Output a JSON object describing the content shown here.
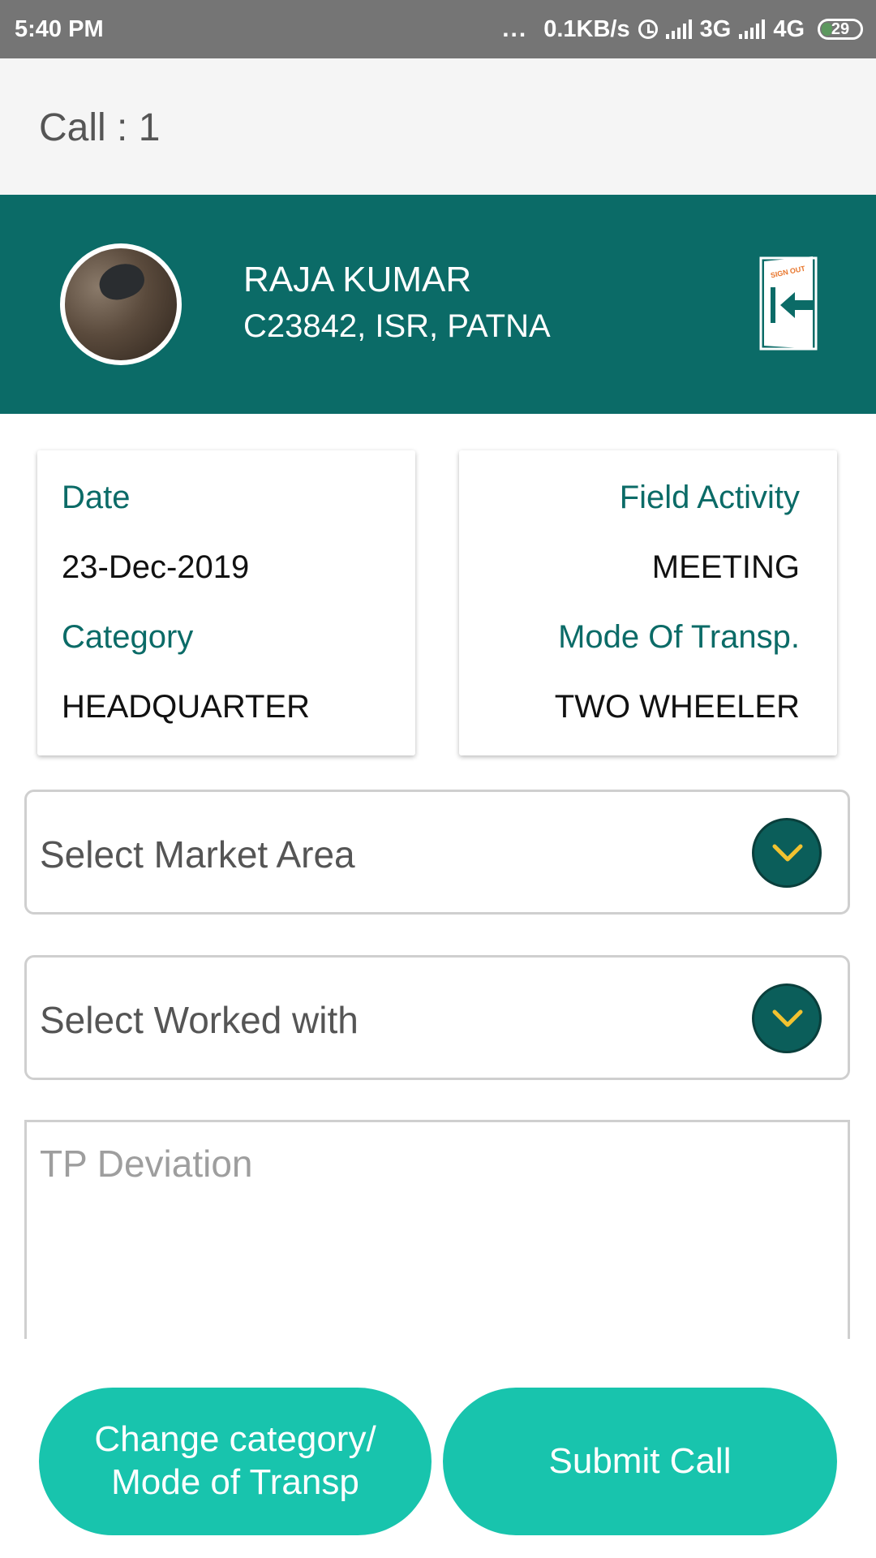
{
  "status_bar": {
    "time": "5:40 PM",
    "dots": "...",
    "network_speed": "0.1KB/s",
    "network1": "3G",
    "network2": "4G",
    "battery": "29",
    "battery_fraction": 0.29
  },
  "app_bar": {
    "title": "Call : 1"
  },
  "profile": {
    "name": "RAJA KUMAR",
    "details": "C23842, ISR, PATNA",
    "sign_out_text": "SIGN OUT",
    "colors": {
      "banner": "#0b6b67",
      "accent": "#18c4ad"
    }
  },
  "card_left": {
    "date_label": "Date",
    "date_value": "23-Dec-2019",
    "category_label": "Category",
    "category_value": "HEADQUARTER"
  },
  "card_right": {
    "field_activity_label": "Field Activity",
    "field_activity_value": "MEETING",
    "mode_label": "Mode Of Transp.",
    "mode_value": "TWO WHEELER"
  },
  "selects": {
    "market_area": "Select Market Area",
    "worked_with": "Select Worked with"
  },
  "tp_deviation": {
    "placeholder": "TP Deviation"
  },
  "buttons": {
    "change_line1": "Change category/",
    "change_line2": "Mode of Transp",
    "submit": "Submit Call"
  }
}
